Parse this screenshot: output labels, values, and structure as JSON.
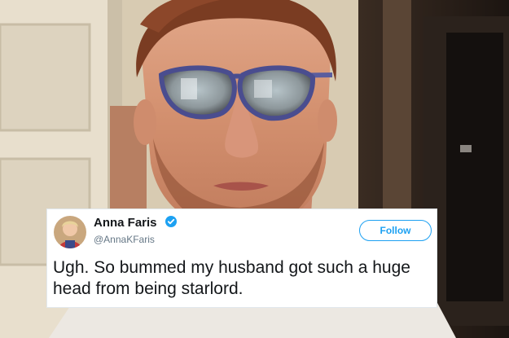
{
  "tweet": {
    "author_name": "Anna Faris",
    "handle": "@AnnaKFaris",
    "follow_label": "Follow",
    "text": "Ugh. So bummed my husband got such a huge head from being starlord.",
    "verified_icon": "verified-badge-icon"
  },
  "colors": {
    "twitter_blue": "#1da1f2",
    "text_dark": "#14171a",
    "text_muted": "#657786"
  }
}
